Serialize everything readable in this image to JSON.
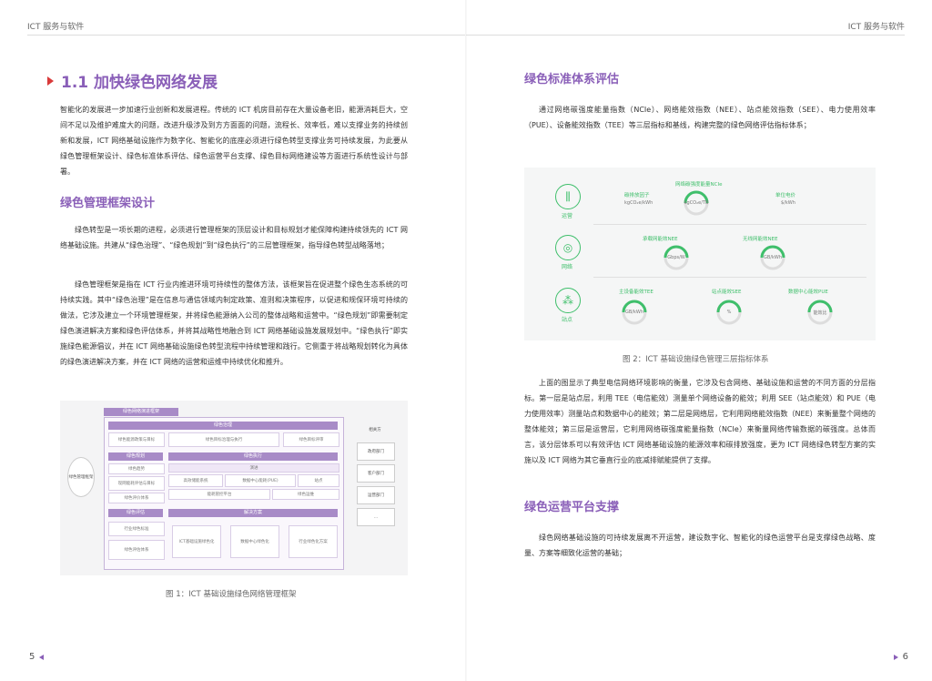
{
  "header": {
    "left": "ICT 服务与软件",
    "right": "ICT 服务与软件"
  },
  "left": {
    "section_title": "1.1  加快绿色网络发展",
    "intro": "智能化的发展进一步加速行业创新和发展进程。传统的 ICT 机房目前存在大量设备老旧，能源消耗巨大，空间不足以及维护难度大的问题，改进升级涉及到方方面面的问题，流程长、效率低，难以支撑业务的持续创新和发展，ICT 网络基础设施作为数字化、智能化的底座必须进行绿色转型支撑业务可持续发展，为此要从绿色管理框架设计、绿色标准体系评估、绿色运营平台支撑、绿色目标网络建设等方面进行系统性设计与部署。",
    "sub1_title": "绿色管理框架设计",
    "sub1_p1": "绿色转型是一项长期的进程，必须进行管理框架的顶层设计和目标规划才能保障构建持续领先的 ICT 网络基础设施。共建从“绿色治理”、“绿色规划”到“绿色执行”的三层管理框架，指导绿色转型战略落地；",
    "sub1_p2": "绿色管理框架是指在 ICT 行业内推进环境可持续性的整体方法，该框架旨在促进整个绿色生态系统的可持续实践。其中“绿色治理”是在信息与通信领域内制定政策、准则和决策程序，以促进和规保环境可持续的做法，它涉及建立一个环境管理框架，并将绿色能源纳入公司的整体战略和运营中。“绿色规划”即需要制定绿色演进解决方案和绿色评估体系，并将其战略性地融合到 ICT 网络基础设施发展规划中。“绿色执行”即实施绿色能源倡议，并在 ICT 网络基础设施绿色转型流程中持续管理和践行。它侧重于将战略规划转化为具体的绿色演进解决方案，并在 ICT 网络的运营和运维中持续优化和推升。",
    "figure1": {
      "frame_title": "绿色网络演进框架",
      "governance": "绿色治理",
      "gov_items": [
        "绿色能源政策与目标",
        "绿色目标治理与执行",
        "绿色目标评审"
      ],
      "planning": "绿色规划",
      "execution": "绿色执行",
      "plan_items": [
        "绿色趋势",
        "现网能耗评估与目标",
        "绿色评价体系"
      ],
      "exec_head": "演进",
      "exec_items": [
        "高效储能系统",
        "数据中心能耗(PUE)",
        "站点"
      ],
      "exec_sub": [
        "能耗管控平台",
        "绿色运维"
      ],
      "eval": "绿色评估",
      "eval_items": [
        "行业绿色标准",
        "绿色评估体系"
      ],
      "solution": "解决方案",
      "sol_items": [
        "ICT基础设施绿色化",
        "数据中心绿色化",
        "行业绿色化方案"
      ],
      "left_node": "绿色管理框架",
      "right_top": "相关方",
      "right_items": [
        "政府部门",
        "客户部门",
        "运营部门",
        "..."
      ]
    },
    "caption": "图 1：ICT 基础设施绿色网络管理框架",
    "page_number": "5"
  },
  "right": {
    "sub2_title": "绿色标准体系评估",
    "sub2_p": "通过网络碳强度能量指数（NCIe）、网络能效指数（NEE）、站点能效指数（SEE）、电力使用效率（PUE）、设备能效指数（TEE）等三层指标和基线，构建完整的绿色网络评估指标体系；",
    "figure2": {
      "rows": [
        {
          "icon": "运营",
          "glyph": "⫼"
        },
        {
          "icon": "网络",
          "glyph": "◎"
        },
        {
          "icon": "站点",
          "glyph": "⁂"
        }
      ],
      "top_title": "网络碳强度能量NCIe",
      "carbon_factor": "碳排放因子",
      "carbon_unit": "kgCO₂e/kWh",
      "center_unit": "kgCO₂e/TB",
      "unit_price": "单位电价",
      "unit_price_unit": "$/kWh",
      "nee_transport": "承载网能效NEE",
      "nee_wireless": "无线网能效NEE",
      "gauge_net1": "Gbps/W",
      "gauge_net2": "GB/kWh",
      "site_tee": "主设备能效TEE",
      "site_see": "站点能效SEE",
      "site_pue": "数据中心能效PUE",
      "gauge_site1": "GB/kWh",
      "gauge_site2": "%",
      "gauge_site3": "能效比"
    },
    "caption": "图 2：ICT 基础设施绿色管理三层指标体系",
    "p2": "上面的图显示了典型电信网络环境影响的衡量，它涉及包含网络、基础设施和运营的不同方面的分层指标。第一层是站点层，利用 TEE（电信能效）测量单个网络设备的能效；利用 SEE（站点能效）和 PUE（电力使用效率）测量站点和数据中心的能效；第二层是网络层，它利用网络能效指数（NEE）来衡量整个网络的整体能效；第三层是运营层，它利用网络碳强度能量指数（NCIe）来衡量网络传输数据的碳强度。总体而言，该分层体系可以有效评估 ICT 网络基础设施的能源效率和碳排放强度，更为 ICT 网络绿色转型方案的实施以及 ICT 网络为其它垂直行业的底减排赋能提供了支撑。",
    "sub3_title": "绿色运营平台支撑",
    "sub3_p": "绿色网络基础设施的可持续发展离不开运营，建设数字化、智能化的绿色运营平台是支撑绿色战略、度量、方案等细致化运营的基础；",
    "page_number": "6"
  },
  "colors": {
    "accent": "#8a5fb8",
    "marker": "#d93a3a",
    "green": "#3fbf6b"
  }
}
